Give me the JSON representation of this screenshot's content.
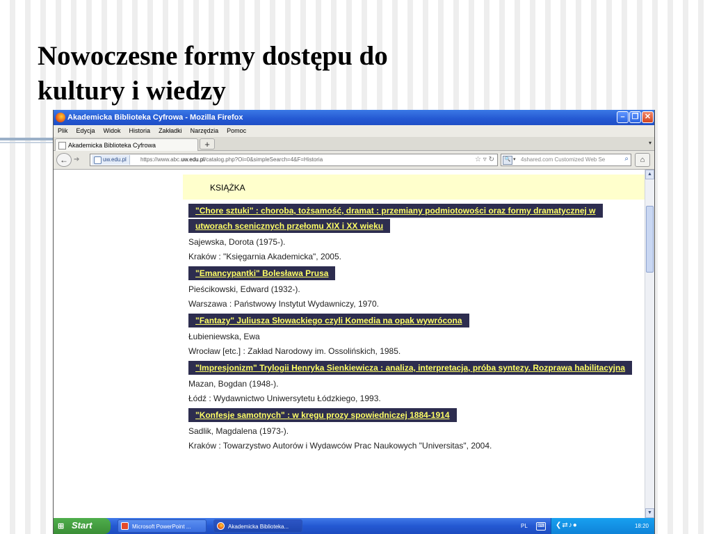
{
  "slide": {
    "title_line1": "Nowoczesne formy dostępu do",
    "title_line2": "kultury i wiedzy"
  },
  "window": {
    "title": "Akademicka Biblioteka Cyfrowa - Mozilla Firefox"
  },
  "menu": [
    "Plik",
    "Edycja",
    "Widok",
    "Historia",
    "Zakładki",
    "Narzędzia",
    "Pomoc"
  ],
  "tab": {
    "label": "Akademicka Biblioteka Cyfrowa",
    "new_tab": "+"
  },
  "address": {
    "identity": "uw.edu.pl",
    "url_prefix": "https://www.abc.",
    "url_domain": "uw.edu.pl",
    "url_path": "/catalog.php?Oi=0&simpleSearch=4&F=Historia"
  },
  "search": {
    "placeholder": "4shared.com Customized Web Se"
  },
  "page": {
    "section_header": "KSIĄŻKA",
    "results": [
      {
        "title": "\"Chore sztuki\" : choroba, tożsamość, dramat : przemiany podmiotowości oraz formy dramatycznej w utworach scenicznych przełomu XIX i XX wieku",
        "author": "Sajewska, Dorota (1975-).",
        "imprint": "Kraków : \"Księgarnia Akademicka\", 2005."
      },
      {
        "title": "\"Emancypantki\" Bolesława Prusa",
        "author": "Pieścikowski, Edward (1932-).",
        "imprint": "Warszawa : Państwowy Instytut Wydawniczy, 1970."
      },
      {
        "title": "\"Fantazy\" Juliusza Słowackiego czyli Komedia na opak wywrócona",
        "author": "Łubieniewska, Ewa",
        "imprint": "Wrocław [etc.] : Zakład Narodowy im. Ossolińskich, 1985."
      },
      {
        "title": "\"Impresjonizm\" Trylogii Henryka Sienkiewicza : analiza, interpretacja, próba syntezy. Rozprawa habilitacyjna",
        "author": "Mazan, Bogdan (1948-).",
        "imprint": "Łódź : Wydawnictwo Uniwersytetu Łódzkiego, 1993."
      },
      {
        "title": "\"Konfesje samotnych\" : w kręgu prozy spowiedniczej 1884-1914",
        "author": "Sadlik, Magdalena (1973-).",
        "imprint": "Kraków : Towarzystwo Autorów i Wydawców Prac Naukowych \"Universitas\", 2004."
      }
    ]
  },
  "taskbar": {
    "start": "Start",
    "tasks": [
      "Microsoft PowerPoint ...",
      "Akademicka Biblioteka..."
    ],
    "lang": "PL",
    "clock": "18:20"
  },
  "colors": {
    "result_title_bg": "#2d2d4f",
    "result_title_fg": "#ffff66",
    "header_bg": "#ffffcc"
  }
}
